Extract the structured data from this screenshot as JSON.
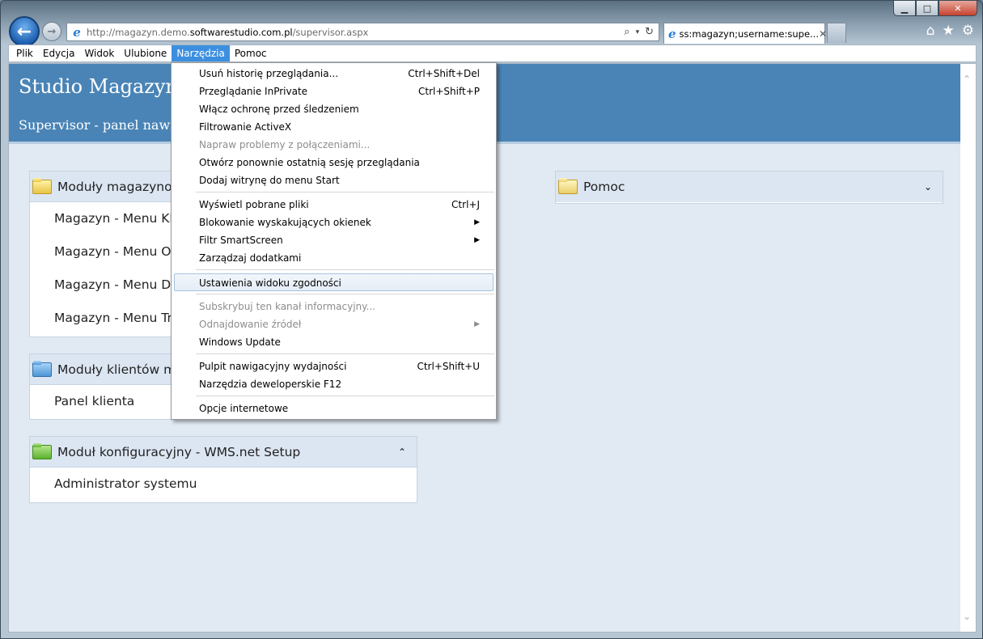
{
  "browser": {
    "url_prefix": "http://magazyn.demo.",
    "url_domain": "softwarestudio.com.pl",
    "url_path": "/supervisor.aspx",
    "tab_title": "ss:magazyn;username:supe...",
    "window_controls": {
      "minimize": "▁",
      "maximize": "□",
      "close": "✕"
    }
  },
  "menubar": {
    "items": [
      {
        "label": "Plik"
      },
      {
        "label": "Edycja"
      },
      {
        "label": "Widok"
      },
      {
        "label": "Ulubione"
      },
      {
        "label": "Narzędzia"
      },
      {
        "label": "Pomoc"
      }
    ],
    "active": "Narzędzia"
  },
  "page": {
    "title": "Studio Magazyn",
    "subtitle": "Supervisor - panel nawi",
    "panels": {
      "warehouse": {
        "title": "Moduły magazynow",
        "items": [
          "Magazyn - Menu Kla",
          "Magazyn - Menu Ou",
          "Magazyn - Menu De",
          "Magazyn - Menu Tra"
        ]
      },
      "clients": {
        "title": "Moduły klientów ma",
        "items": [
          "Panel klienta"
        ]
      },
      "config": {
        "title": "Moduł konfiguracyjny - WMS.net Setup",
        "toggle": "⌃",
        "items": [
          "Administrator systemu"
        ]
      },
      "help": {
        "title": "Pomoc",
        "toggle": "⌄"
      }
    }
  },
  "tools_menu": {
    "items": [
      {
        "label": "Usuń historię przeglądania...",
        "shortcut": "Ctrl+Shift+Del"
      },
      {
        "label": "Przeglądanie InPrivate",
        "shortcut": "Ctrl+Shift+P"
      },
      {
        "label": "Włącz ochronę przed śledzeniem",
        "shortcut": ""
      },
      {
        "label": "Filtrowanie ActiveX",
        "shortcut": ""
      },
      {
        "label": "Napraw problemy z połączeniami...",
        "shortcut": ""
      },
      {
        "label": "Otwórz ponownie ostatnią sesję przeglądania",
        "shortcut": ""
      },
      {
        "label": "Dodaj witrynę do menu Start",
        "shortcut": ""
      },
      {
        "label": "Wyświetl pobrane pliki",
        "shortcut": "Ctrl+J"
      },
      {
        "label": "Blokowanie wyskakujących okienek",
        "shortcut": ""
      },
      {
        "label": "Filtr SmartScreen",
        "shortcut": ""
      },
      {
        "label": "Zarządzaj dodatkami",
        "shortcut": ""
      },
      {
        "label": "Ustawienia widoku zgodności",
        "shortcut": ""
      },
      {
        "label": "Subskrybuj ten kanał informacyjny...",
        "shortcut": ""
      },
      {
        "label": "Odnajdowanie źródeł",
        "shortcut": ""
      },
      {
        "label": "Windows Update",
        "shortcut": ""
      },
      {
        "label": "Pulpit nawigacyjny wydajności",
        "shortcut": "Ctrl+Shift+U"
      },
      {
        "label": "Narzędzia deweloperskie F12",
        "shortcut": ""
      },
      {
        "label": "Opcje internetowe",
        "shortcut": ""
      }
    ]
  },
  "icons": [
    "back-arrow-icon",
    "forward-arrow-icon",
    "ie-logo-icon",
    "search-icon",
    "refresh-icon",
    "home-icon",
    "favorites-star-icon",
    "settings-gear-icon",
    "folder-icon",
    "submenu-arrow-icon"
  ]
}
